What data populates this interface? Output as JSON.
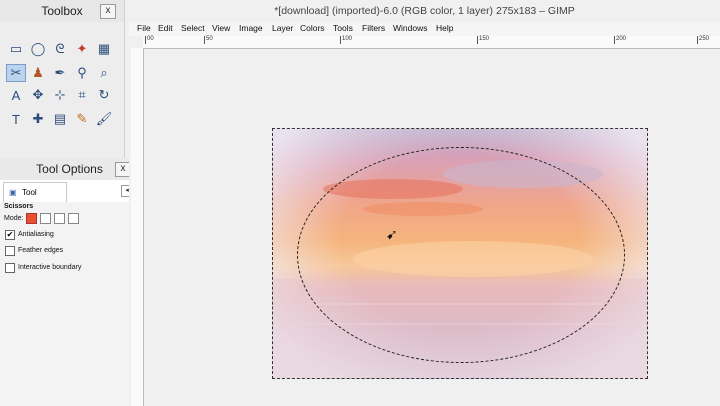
{
  "toolbox": {
    "title": "Toolbox",
    "close_label": "x"
  },
  "tool_options": {
    "title": "Tool Options",
    "close_label": "x",
    "tab_label": "Tool Options",
    "tool_name": "Scissors",
    "mode_label": "Mode:",
    "antialiasing_label": "Antialiasing",
    "feather_label": "Feather edges",
    "interactive_label": "Interactive boundary",
    "antialiasing_checked": "✔"
  },
  "image_window": {
    "title": "*[download] (imported)-6.0 (RGB color, 1 layer) 275x183 – GIMP",
    "menu": [
      "File",
      "Edit",
      "Select",
      "View",
      "Image",
      "Layer",
      "Colors",
      "Tools",
      "Filters",
      "Windows",
      "Help"
    ],
    "ruler_ticks": [
      "00",
      "50",
      "100",
      "150",
      "200",
      "250"
    ]
  }
}
